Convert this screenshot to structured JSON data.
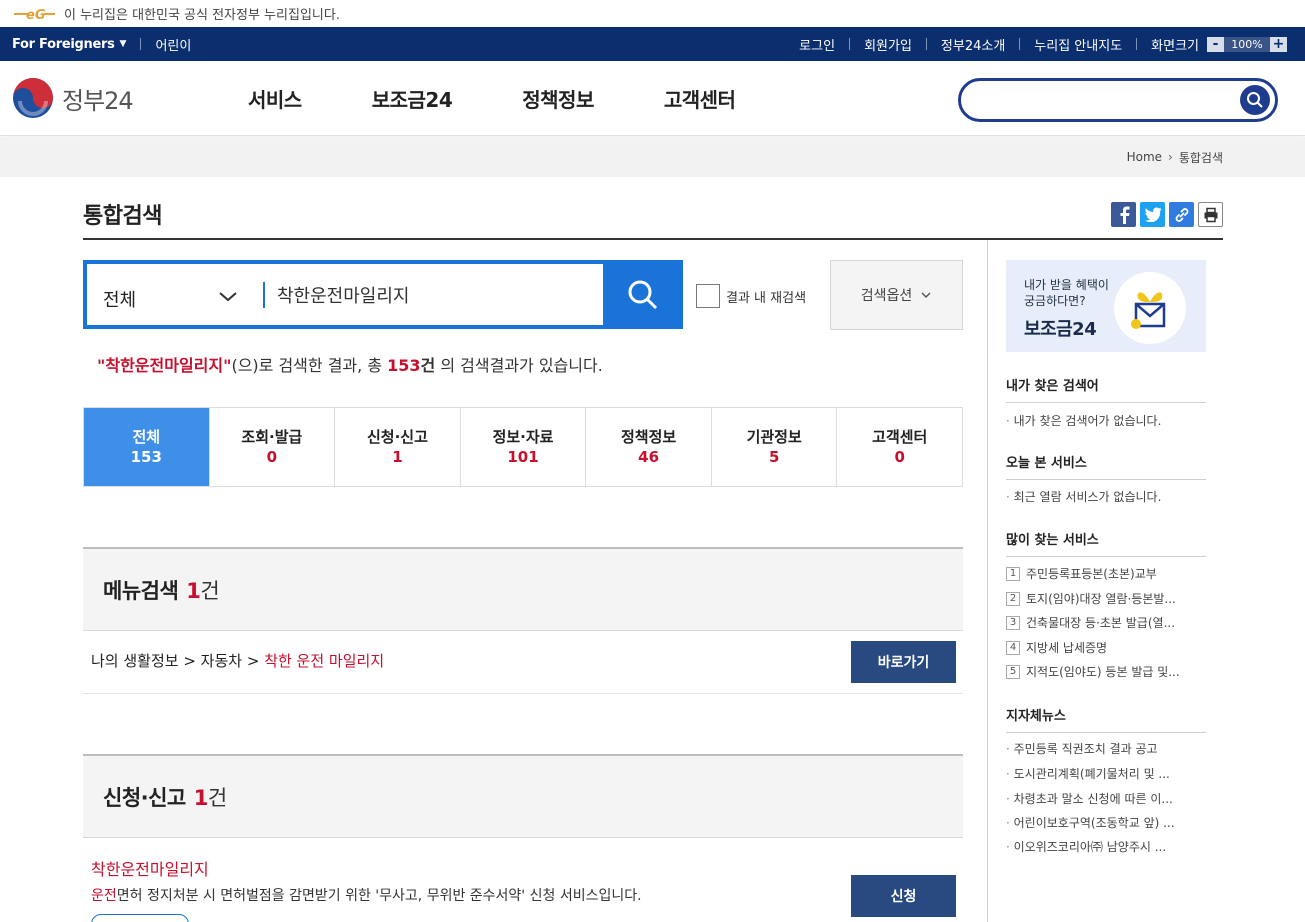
{
  "notice": {
    "text": "이 누리집은 대한민국 공식 전자정부 누리집입니다."
  },
  "util": {
    "foreigners": "For Foreigners",
    "kids": "어린이",
    "links": [
      "로그인",
      "회원가입",
      "정부24소개",
      "누리집 안내지도",
      "화면크기"
    ],
    "zoom_value": "100%",
    "zoom_minus": "-",
    "zoom_plus": "+"
  },
  "header": {
    "logo_text": "정부24",
    "gnb": [
      "서비스",
      "보조금24",
      "정책정보",
      "고객센터"
    ],
    "search_placeholder": ""
  },
  "breadcrumb": {
    "home": "Home",
    "current": "통합검색"
  },
  "page_title": "통합검색",
  "search": {
    "scope": "전체",
    "query": "착한운전마일리지",
    "research_label": "결과 내 재검색",
    "options_label": "검색옵션"
  },
  "summary": {
    "quote_open": "\"",
    "keyword": "착한운전마일리지",
    "quote_close": "\"",
    "mid": "(으)로 검색한 결과, 총 ",
    "count": "153",
    "unit": "건",
    "tail": " 의 검색결과가 있습니다."
  },
  "tabs": [
    {
      "label": "전체",
      "count": "153"
    },
    {
      "label": "조회·발급",
      "count": "0"
    },
    {
      "label": "신청·신고",
      "count": "1"
    },
    {
      "label": "정보·자료",
      "count": "101"
    },
    {
      "label": "정책정보",
      "count": "46"
    },
    {
      "label": "기관정보",
      "count": "5"
    },
    {
      "label": "고객센터",
      "count": "0"
    }
  ],
  "menu_section": {
    "title": "메뉴검색",
    "count": "1",
    "unit": "건",
    "path_prefix": "나의 생활정보 > 자동차 > ",
    "path_highlight": "착한 운전 마일리지",
    "button": "바로가기"
  },
  "apply_section": {
    "title": "신청·신고",
    "count": "1",
    "unit": "건",
    "item_title": "착한운전마일리지",
    "desc_highlight": "운전",
    "desc_rest": "면허 정지처분 시 면허벌점을 감면받기 위한 '무사고, 무위반 준수서약' 신청 서비스입니다.",
    "button": "신청"
  },
  "sidebar": {
    "banner_line1": "내가 받을 혜택이",
    "banner_line2": "궁금하다면?",
    "banner_brand": "보조금24",
    "my_keywords_title": "내가 찾은 검색어",
    "my_keywords_empty": "내가 찾은 검색어가 없습니다.",
    "today_title": "오늘 본 서비스",
    "today_empty": "최근 열람 서비스가 없습니다.",
    "popular_title": "많이 찾는 서비스",
    "popular": [
      "주민등록표등본(초본)교부",
      "토지(임야)대장 열람·등본발...",
      "건축물대장 등·초본 발급(열...",
      "지방세 납세증명",
      "지적도(임야도) 등본 발급 및..."
    ],
    "news_title": "지자체뉴스",
    "news": [
      "주민등록 직권조치 결과 공고",
      "도시관리계획(폐기물처리 및 ...",
      "차령초과 말소 신청에 따른 이...",
      "어린이보호구역(조동학교 앞) ...",
      "이오위즈코리아㈜ 남양주시 ..."
    ]
  },
  "colors": {
    "navy": "#0b2e6e",
    "accent_blue": "#1a73d9",
    "highlight_red": "#c8102e",
    "button_navy": "#284a80"
  }
}
